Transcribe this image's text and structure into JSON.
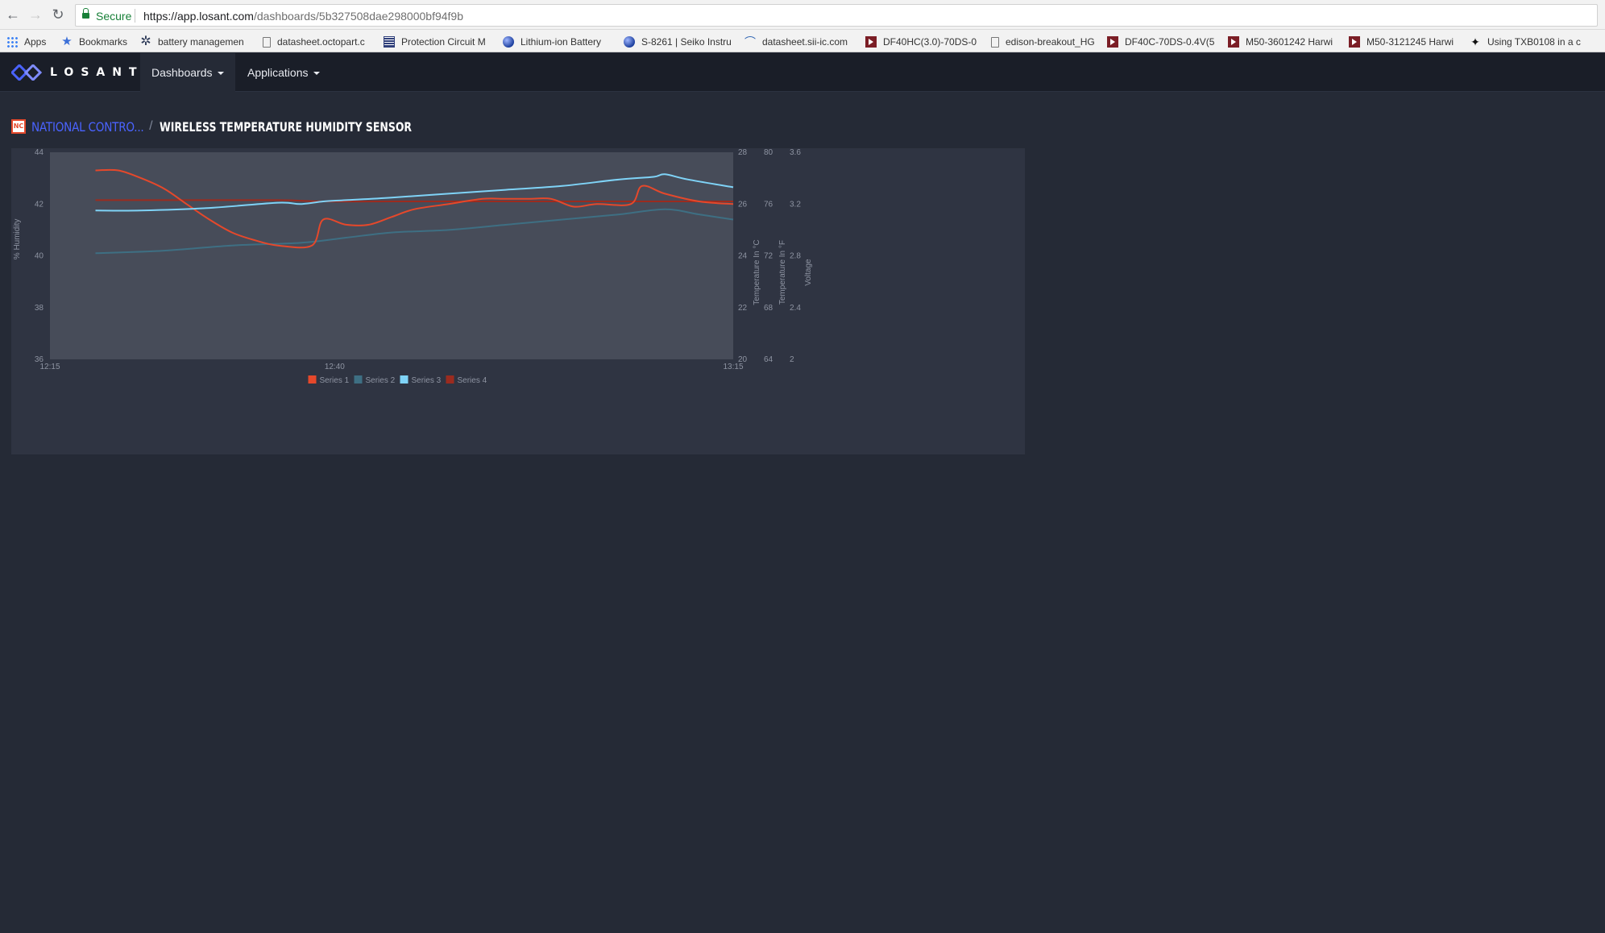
{
  "browser": {
    "secure_label": "Secure",
    "url_host": "https://app.losant.com",
    "url_path": "/dashboards/5b327508dae298000bf94f9b",
    "bookmarks": [
      {
        "icon": "apps-icon",
        "label": "Apps"
      },
      {
        "icon": "star-icon",
        "label": "Bookmarks"
      },
      {
        "icon": "gear-icon",
        "label": "battery managemen"
      },
      {
        "icon": "page-icon",
        "label": "datasheet.octopart.c"
      },
      {
        "icon": "grid-icon",
        "label": "Protection Circuit M"
      },
      {
        "icon": "globe-icon",
        "label": "Lithium-ion Battery"
      },
      {
        "icon": "globe-icon",
        "label": "S-8261 | Seiko Instru"
      },
      {
        "icon": "sii-icon",
        "label": "datasheet.sii-ic.com"
      },
      {
        "icon": "mouser-icon",
        "label": "DF40HC(3.0)-70DS-0"
      },
      {
        "icon": "page-icon",
        "label": "edison-breakout_HG"
      },
      {
        "icon": "mouser-icon",
        "label": "DF40C-70DS-0.4V(5"
      },
      {
        "icon": "mouser-icon",
        "label": "M50-3601242 Harwi"
      },
      {
        "icon": "mouser-icon",
        "label": "M50-3121245 Harwi"
      },
      {
        "icon": "ti-icon",
        "label": "Using TXB0108 in a c"
      }
    ]
  },
  "app": {
    "logo_text": "LOSANT",
    "nav": {
      "dashboards": "Dashboards",
      "applications": "Applications"
    }
  },
  "breadcrumb": {
    "badge": "NC",
    "parent": "NATIONAL CONTRO...",
    "separator": "/",
    "current": "WIRELESS TEMPERATURE HUMIDITY SENSOR"
  },
  "colors": {
    "series1": "#e5482b",
    "series2": "#3e6f83",
    "series3": "#7fd3f7",
    "series4": "#9b2b1f",
    "plot_bg": "#474c59",
    "widget_bg": "#2f3442",
    "page_bg": "#252a36"
  },
  "chart_data": {
    "type": "line",
    "title": "",
    "x": [
      "12:15",
      "12:40",
      "13:15"
    ],
    "x_range_minutes": [
      0,
      60
    ],
    "axes": [
      {
        "id": "humidity",
        "label": "% Humidity",
        "position": "left",
        "range": [
          36,
          44
        ],
        "ticks": [
          "36",
          "38",
          "40",
          "42",
          "44"
        ]
      },
      {
        "id": "temp_c",
        "label": "Temperature In °C",
        "position": "right",
        "range": [
          20,
          28
        ],
        "ticks": [
          "20",
          "22",
          "24",
          "26",
          "28"
        ]
      },
      {
        "id": "temp_f",
        "label": "Temperature In °F",
        "position": "right",
        "range": [
          64,
          80
        ],
        "ticks": [
          "64",
          "68",
          "72",
          "76",
          "80"
        ]
      },
      {
        "id": "voltage",
        "label": "Voltage",
        "position": "right",
        "range": [
          2,
          3.6
        ],
        "ticks": [
          "2",
          "2.4",
          "2.8",
          "3.2",
          "3.6"
        ]
      }
    ],
    "series": [
      {
        "name": "Series 1",
        "axis": "humidity",
        "color": "#e5482b",
        "points": [
          [
            4,
            43.3
          ],
          [
            6,
            43.3
          ],
          [
            8,
            43.0
          ],
          [
            10,
            42.6
          ],
          [
            12,
            42.0
          ],
          [
            14,
            41.4
          ],
          [
            16,
            40.9
          ],
          [
            18,
            40.6
          ],
          [
            20,
            40.4
          ],
          [
            23,
            40.4
          ],
          [
            24,
            41.4
          ],
          [
            26,
            41.2
          ],
          [
            28,
            41.2
          ],
          [
            30,
            41.5
          ],
          [
            32,
            41.8
          ],
          [
            35,
            42.0
          ],
          [
            38,
            42.2
          ],
          [
            40,
            42.2
          ],
          [
            42,
            42.2
          ],
          [
            44,
            42.2
          ],
          [
            46,
            41.9
          ],
          [
            48,
            42.0
          ],
          [
            51,
            42.0
          ],
          [
            52,
            42.7
          ],
          [
            54,
            42.4
          ],
          [
            57,
            42.1
          ],
          [
            60,
            42.0
          ]
        ]
      },
      {
        "name": "Series 2",
        "axis": "temp_c",
        "color": "#3e6f83",
        "points": [
          [
            4,
            24.1
          ],
          [
            10,
            24.2
          ],
          [
            16,
            24.4
          ],
          [
            22,
            24.5
          ],
          [
            26,
            24.7
          ],
          [
            30,
            24.9
          ],
          [
            35,
            25.0
          ],
          [
            40,
            25.2
          ],
          [
            45,
            25.4
          ],
          [
            50,
            25.6
          ],
          [
            54,
            25.8
          ],
          [
            57,
            25.6
          ],
          [
            60,
            25.4
          ]
        ]
      },
      {
        "name": "Series 3",
        "axis": "temp_f",
        "color": "#7fd3f7",
        "points": [
          [
            4,
            75.5
          ],
          [
            8,
            75.5
          ],
          [
            14,
            75.7
          ],
          [
            20,
            76.1
          ],
          [
            22,
            76.0
          ],
          [
            24,
            76.2
          ],
          [
            26,
            76.3
          ],
          [
            30,
            76.5
          ],
          [
            35,
            76.8
          ],
          [
            40,
            77.1
          ],
          [
            45,
            77.4
          ],
          [
            50,
            77.9
          ],
          [
            53,
            78.1
          ],
          [
            54,
            78.3
          ],
          [
            56,
            77.9
          ],
          [
            60,
            77.3
          ]
        ]
      },
      {
        "name": "Series 4",
        "axis": "voltage",
        "color": "#9b2b1f",
        "points": [
          [
            4,
            3.23
          ],
          [
            10,
            3.23
          ],
          [
            20,
            3.23
          ],
          [
            24,
            3.22
          ],
          [
            30,
            3.22
          ],
          [
            40,
            3.22
          ],
          [
            50,
            3.22
          ],
          [
            60,
            3.22
          ]
        ]
      }
    ],
    "legend": {
      "position": "bottom-center",
      "entries": [
        "Series 1",
        "Series 2",
        "Series 3",
        "Series 4"
      ]
    },
    "grid": false
  }
}
